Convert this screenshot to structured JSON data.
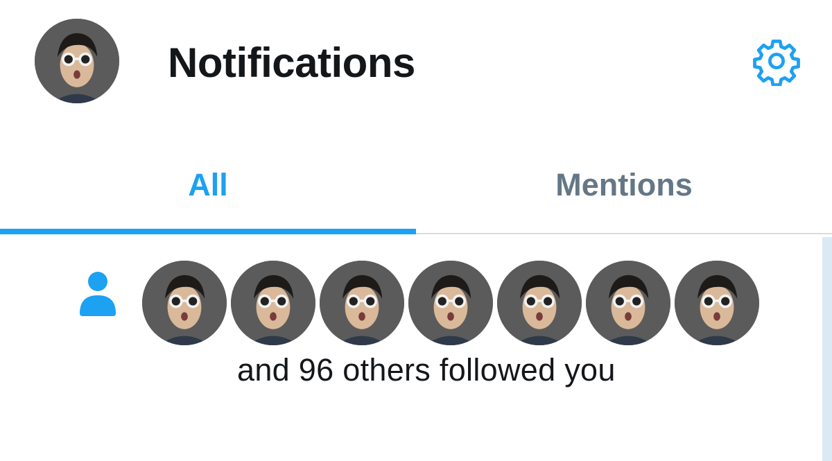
{
  "header": {
    "title": "Notifications",
    "profile_icon": "profile-avatar",
    "settings_icon": "gear-icon"
  },
  "tabs": [
    {
      "label": "All",
      "active": true
    },
    {
      "label": "Mentions",
      "active": false
    }
  ],
  "notification": {
    "type_icon": "person-icon",
    "avatar_count": 7,
    "text": "and 96 others followed you"
  },
  "colors": {
    "accent": "#1da1f2",
    "inactive_tab": "#657786",
    "text": "#14171a"
  }
}
